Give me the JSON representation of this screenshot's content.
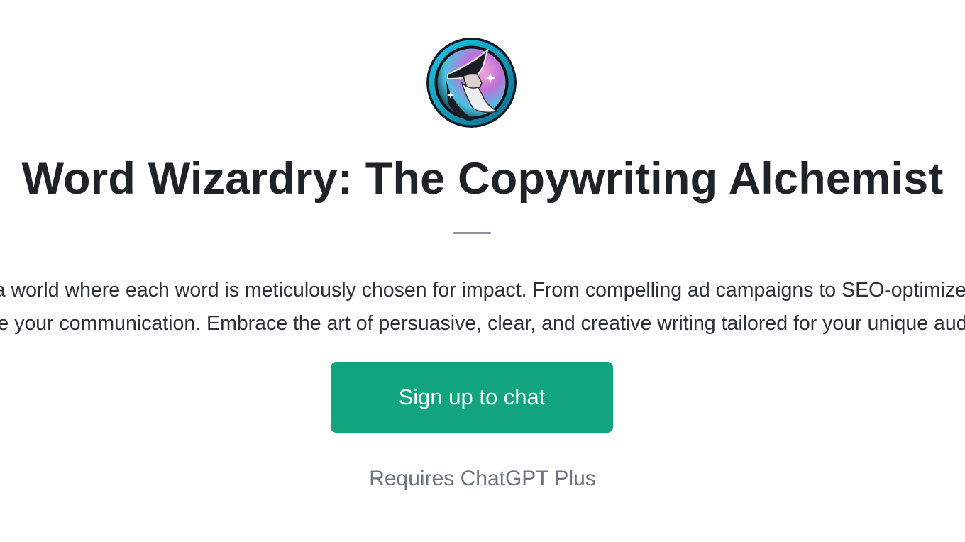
{
  "gpt": {
    "title": "Word Wizardry: The Copywriting Alchemist",
    "description_lines": [
      "Dive into a world where each word is meticulously chosen for impact. From compelling ad campaigns to SEO-optimized content,",
      "elevate your communication. Embrace the art of persuasive, clear, and creative writing tailored for your unique audience."
    ],
    "avatar_icon": "wizard-avatar-icon"
  },
  "cta": {
    "label": "Sign up to chat",
    "color": "#12a37f"
  },
  "requirement": "Requires ChatGPT Plus"
}
